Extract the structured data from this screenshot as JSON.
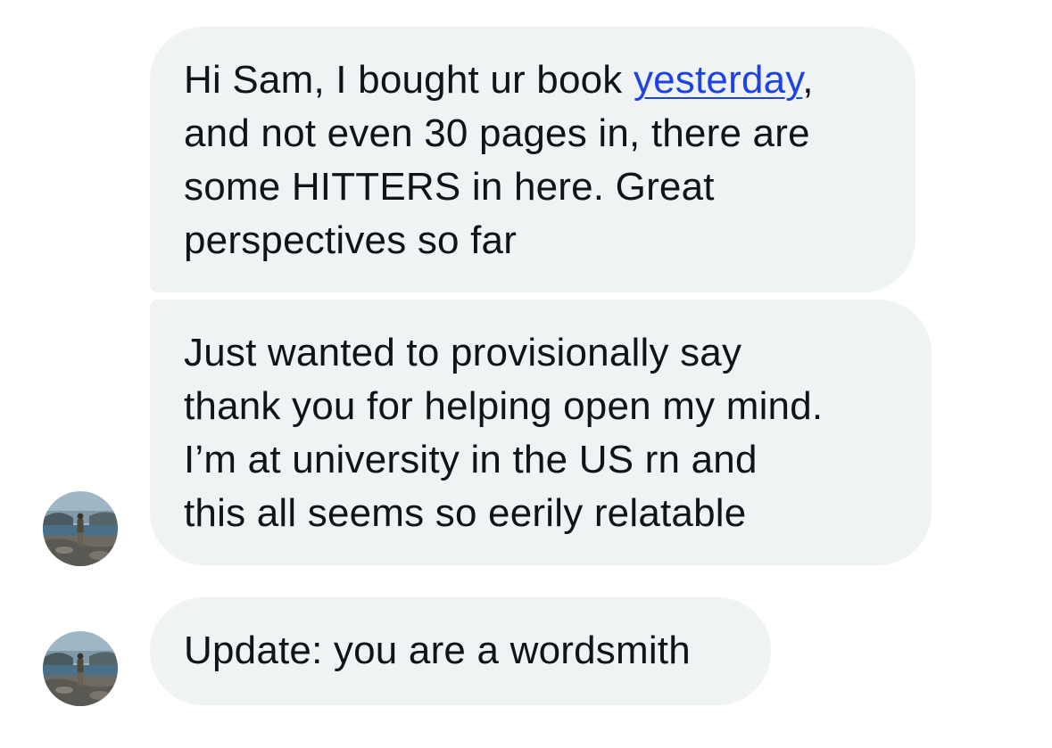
{
  "conversation": {
    "messages": [
      {
        "lines": [
          {
            "before": "Hi Sam, I bought ur book ",
            "link": "yesterday",
            "after": ","
          },
          "and not even 30 pages in, there are",
          "some HITTERS in here. Great",
          "perspectives so far"
        ]
      },
      {
        "lines": [
          "Just wanted to provisionally say",
          "thank you for helping open my mind.",
          "I’m at university in the US rn and",
          "this all seems so eerily relatable"
        ]
      },
      {
        "lines": [
          "Update: you are a wordsmith"
        ]
      }
    ]
  },
  "colors": {
    "bubble_bg": "#eff3f4",
    "text": "#0f1419",
    "link": "#1d44e0"
  },
  "icons": {
    "avatar": "user-avatar-photo"
  }
}
